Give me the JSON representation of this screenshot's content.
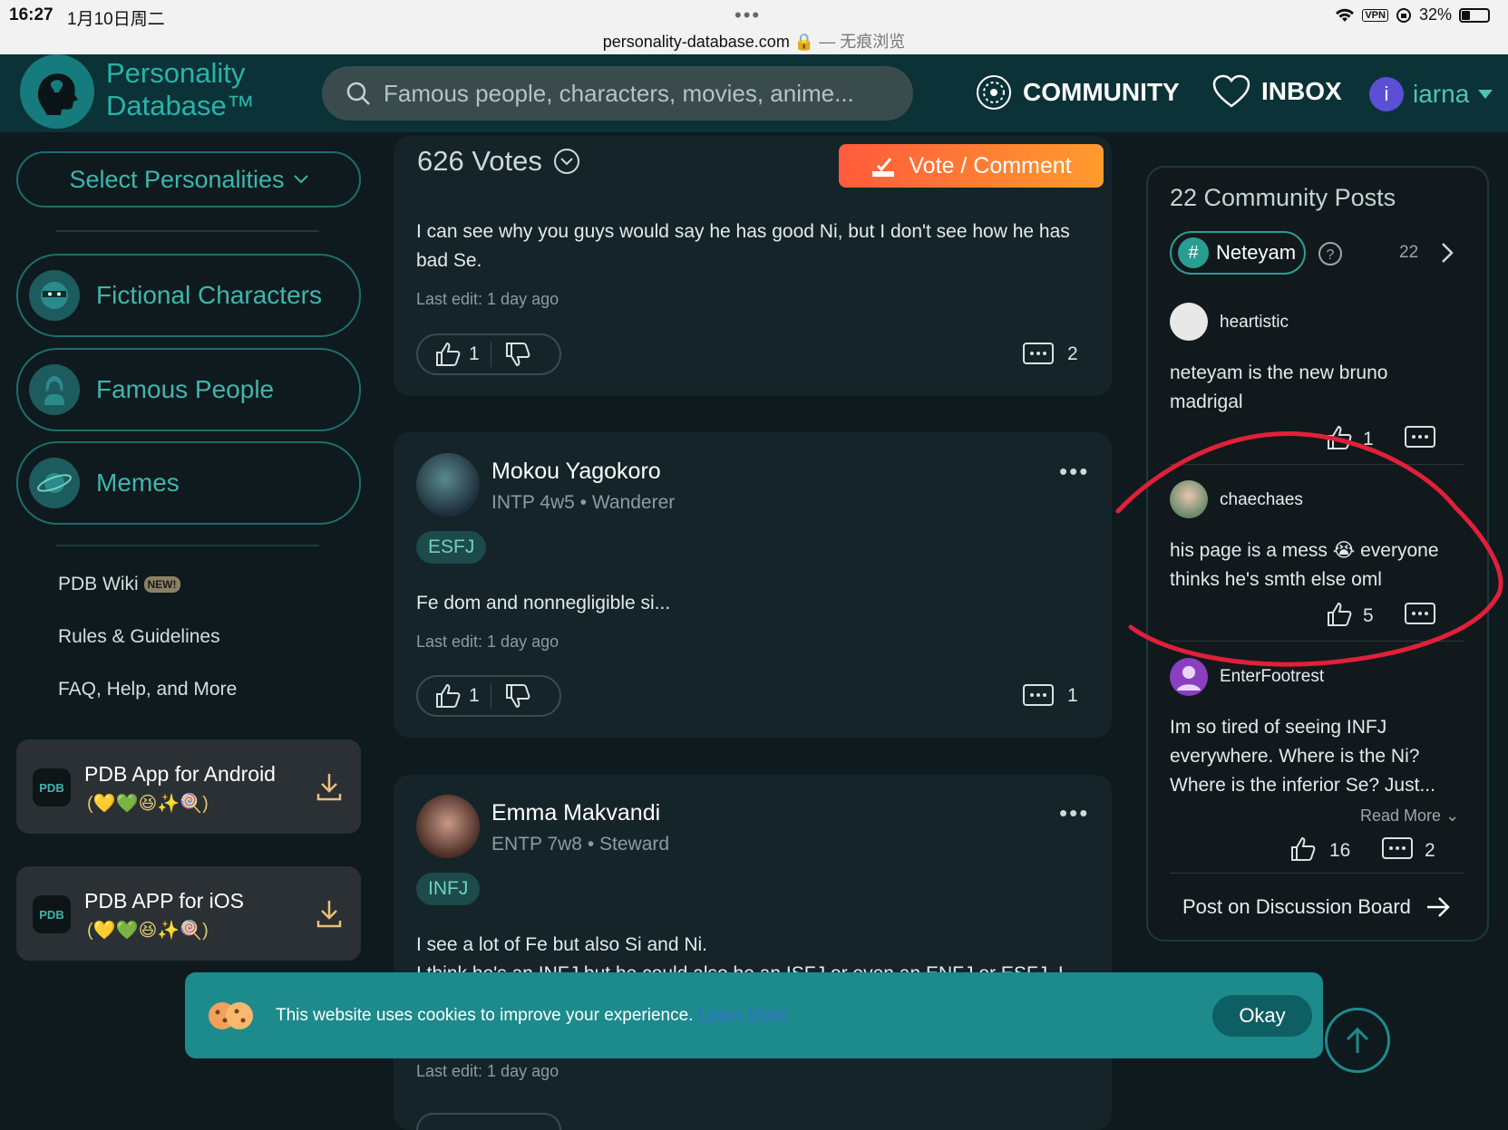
{
  "status": {
    "time": "16:27",
    "date": "1月10日周二",
    "url": "personality-database.com",
    "private_label": "— 无痕浏览",
    "vpn": "VPN",
    "battery": "32%"
  },
  "header": {
    "logo_line1": "Personality",
    "logo_line2": "Database™",
    "search_placeholder": "Famous people, characters, movies, anime...",
    "community": "COMMUNITY",
    "inbox": "INBOX",
    "user_initial": "i",
    "username": "iarna"
  },
  "sidebar": {
    "select_label": "Select Personalities",
    "categories": [
      "Fictional Characters",
      "Famous People",
      "Memes"
    ],
    "links": [
      "PDB Wiki",
      "Rules & Guidelines",
      "FAQ, Help, and More"
    ],
    "new_badge": "NEW!",
    "apps": [
      {
        "title": "PDB App for Android",
        "emoji": "(💛💚😆✨🍭)"
      },
      {
        "title": "PDB APP for iOS",
        "emoji": "(💛💚😆✨🍭)"
      }
    ],
    "app_icon_text": "PDB"
  },
  "feed": {
    "votes_label": "626 Votes",
    "vote_button": "Vote / Comment",
    "posts": [
      {
        "text": "I can see why you guys would say he has good Ni, but I don't see how he has bad Se.",
        "edit": "Last edit: 1 day ago",
        "likes": "1",
        "comments": "2"
      },
      {
        "name": "Mokou Yagokoro",
        "type": "INTP 4w5 • Wanderer",
        "tag": "ESFJ",
        "text": "Fe dom and nonnegligible si...",
        "edit": "Last edit: 1 day ago",
        "likes": "1",
        "comments": "1"
      },
      {
        "name": "Emma Makvandi",
        "type": "ENTP 7w8 • Steward",
        "tag": "INFJ",
        "text": "I see a lot of Fe but also Si and Ni.",
        "text2": "I think he's an INFJ but he could also be an ISFJ or even an ENFJ or ESFJ. I",
        "edit": "Last edit: 1 day ago"
      }
    ]
  },
  "community": {
    "title": "22 Community Posts",
    "hashtag": "Neteyam",
    "count": "22",
    "posts": [
      {
        "user": "heartistic",
        "text": "neteyam is the new bruno madrigal",
        "likes": "1"
      },
      {
        "user": "chaechaes",
        "text": "his page is a mess 😭 everyone thinks he's smth else oml",
        "likes": "5"
      },
      {
        "user": "EnterFootrest",
        "text": "Im so tired of seeing INFJ everywhere. Where is the Ni? Where is the inferior Se? Just...",
        "read_more": "Read More",
        "likes": "16",
        "comments": "2"
      }
    ],
    "post_board": "Post on Discussion Board"
  },
  "cookie": {
    "text": "This website uses cookies to improve your experience.",
    "learn_more": "Learn More",
    "okay": "Okay"
  },
  "colors": {
    "accent": "#2ab3a9",
    "annotation": "#e0203a",
    "vote_gradient_start": "#ff5b3c",
    "vote_gradient_end": "#ff9b2e"
  }
}
